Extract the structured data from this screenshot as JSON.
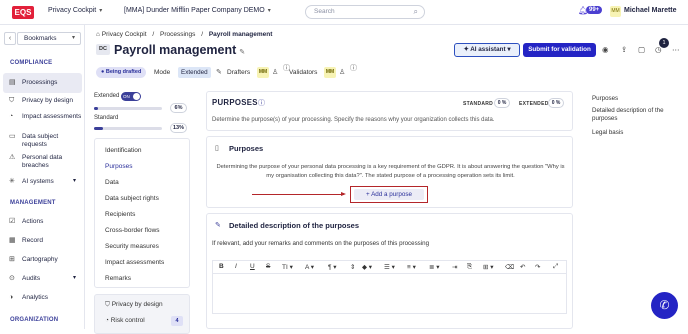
{
  "topbar": {
    "logo": "EQS",
    "app": "Privacy Cockpit",
    "company": "[MMA] Dunder Mifflin Paper Company DEMO",
    "search_placeholder": "Search",
    "notification_count": "99+",
    "user_initials": "MM",
    "user_name": "Michael Marette"
  },
  "sidebar": {
    "bookmarks": "Bookmarks",
    "compliance_title": "COMPLIANCE",
    "compliance_items": [
      "Processings",
      "Privacy by design",
      "Impact assessments",
      "Data subject requests",
      "Personal data breaches",
      "AI systems"
    ],
    "management_title": "MANAGEMENT",
    "management_items": [
      "Actions",
      "Record",
      "Cartography",
      "Audits",
      "Analytics"
    ],
    "organization_title": "ORGANIZATION"
  },
  "breadcrumb": {
    "items": [
      "Privacy Cockpit",
      "Processings",
      "Payroll management"
    ],
    "sep": "/"
  },
  "header": {
    "badge": "DC",
    "title": "Payroll management",
    "ai_assistant": "AI assistant",
    "submit": "Submit for validation",
    "count_badge": "1",
    "status": "Being drafted",
    "mode_label": "Mode",
    "mode_value": "Extended",
    "drafters_label": "Drafters",
    "drafter_initials": "MM",
    "validators_label": "Validators",
    "validator_initials": "MM"
  },
  "levels": {
    "extended_label": "Extended",
    "toggle_text": "ON",
    "extended_pct": "6%",
    "extended_fill": 0.06,
    "standard_label": "Standard",
    "standard_pct": "13%",
    "standard_fill": 0.13
  },
  "subnav": {
    "items": [
      "Identification",
      "Purposes",
      "Data",
      "Data subject rights",
      "Recipients",
      "Cross-border flows",
      "Security measures",
      "Impact assessments",
      "Remarks"
    ],
    "privacy_by_design": "Privacy by design",
    "risk_control": "Risk control",
    "risk_count": "4"
  },
  "purposes_section": {
    "title": "PURPOSES",
    "description": "Determine the purpose(s) of your processing. Specify the reasons why your organization collects this data.",
    "standard_label": "STANDARD",
    "standard_pct": "0 %",
    "extended_label": "EXTENDED",
    "extended_pct": "0 %"
  },
  "purposes_card": {
    "title": "Purposes",
    "desc_line1": "Determining the purpose of your personal data processing is a key requirement of the GDPR. It is about answering the question \"Why is",
    "desc_line2": "my organisation collecting this data?\". The stated purpose of a processing operation sets its limit.",
    "add_button": "Add a purpose"
  },
  "detailed_card": {
    "title": "Detailed description of the purposes",
    "description": "If relevant, add your remarks and comments on the purposes of this processing"
  },
  "right_nav": {
    "items": [
      "Purposes",
      "Detailed description of the purposes",
      "Legal basis"
    ]
  }
}
